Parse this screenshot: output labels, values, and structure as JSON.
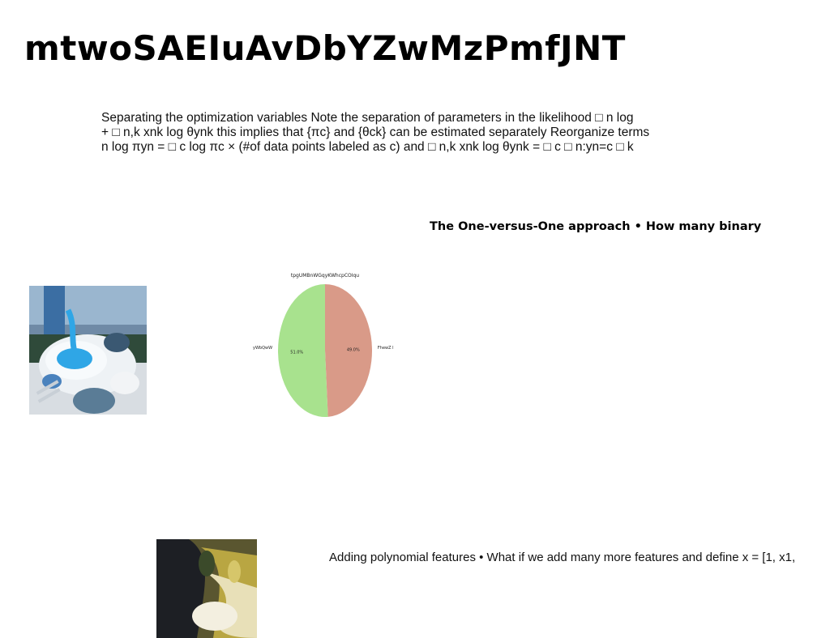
{
  "title": "mtwoSAEIuAvDbYZwMzPmfJNT",
  "paragraph": {
    "lines": [
      "Separating the optimization variables Note the separation of parameters in the likelihood □ n log",
      "+ □ n,k xnk log θynk this implies that {πc} and {θck} can be estimated separately Reorganize terms",
      "n log πyn = □ c log πc × (#of data points labeled as c) and □ n,k xnk log θynk = □ c □ n:yn=c □ k"
    ]
  },
  "heading_ovo": "The One-versus-One approach • How many binary",
  "caption_poly": "Adding polynomial features • What if we add many more features and define x = [1, x1,",
  "chart_data": {
    "type": "pie",
    "title": "tpgUMBnWGqyKWhcpCOIqu",
    "slices": [
      {
        "label": "FhewZ l",
        "value": 49.0,
        "pct_label": "49.0%",
        "color": "#d99a88"
      },
      {
        "label": "yWbQwW",
        "value": 51.0,
        "pct_label": "51.0%",
        "color": "#a8e28e"
      }
    ],
    "start_angle_deg": 90,
    "counterclockwise": false
  },
  "images": {
    "photo_table": "photo of a table setting with a bowl of blue liquid",
    "photo_abstract": "abstract macro photo with yellow and white tones"
  }
}
